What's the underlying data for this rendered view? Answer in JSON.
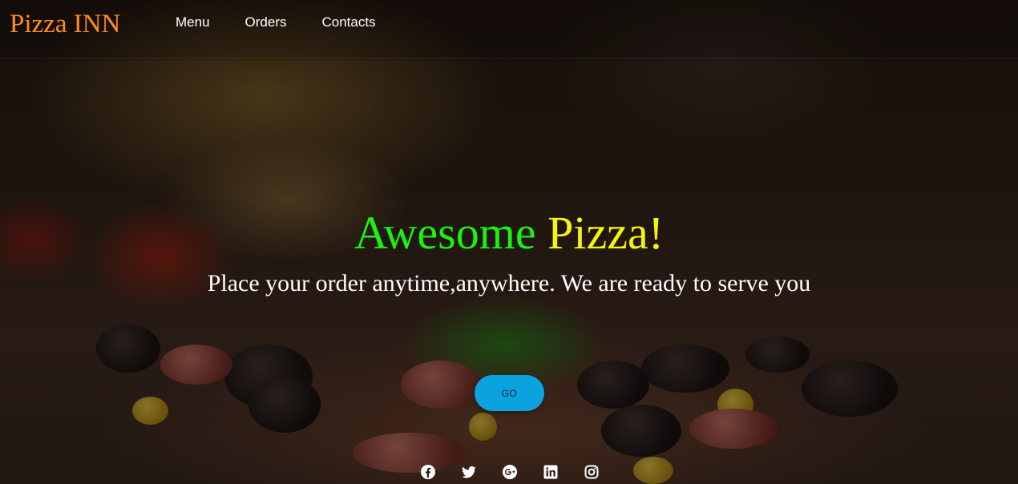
{
  "brand": {
    "name": "Pizza INN",
    "color": "#ff8c1a"
  },
  "nav": {
    "items": [
      {
        "label": "Menu"
      },
      {
        "label": "Orders"
      },
      {
        "label": "Contacts"
      }
    ]
  },
  "hero": {
    "headline_word1": "Awesome",
    "headline_word2": "Pizza!",
    "headline_word1_color": "#1bf20f",
    "headline_word2_color": "#f5f507",
    "tagline": "Place your order anytime,anywhere. We are ready to serve you",
    "cta_label": "GO",
    "cta_color": "#0ba3df"
  },
  "social": {
    "icons": [
      "facebook-icon",
      "twitter-icon",
      "google-plus-icon",
      "linkedin-icon",
      "instagram-icon"
    ]
  }
}
